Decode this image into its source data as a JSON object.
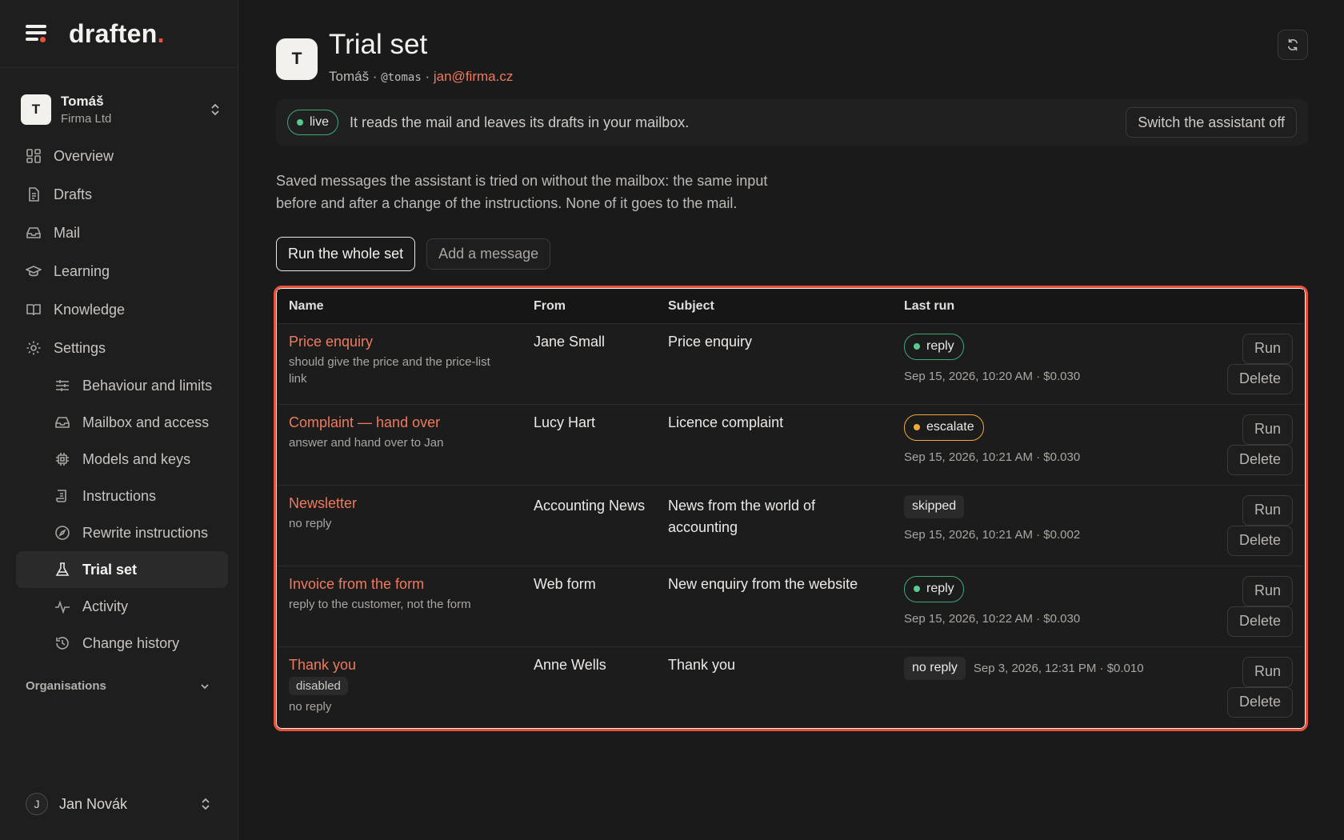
{
  "brand": {
    "logo_text": "draften",
    "logo_dot": ".",
    "accent": "#e5553b"
  },
  "org": {
    "avatar": "T",
    "name": "Tomáš",
    "company": "Firma Ltd"
  },
  "nav": {
    "overview": "Overview",
    "drafts": "Drafts",
    "mail": "Mail",
    "learning": "Learning",
    "knowledge": "Knowledge",
    "settings": "Settings",
    "behaviour": "Behaviour and limits",
    "mailbox": "Mailbox and access",
    "models": "Models and keys",
    "instructions": "Instructions",
    "rewrite": "Rewrite instructions",
    "trial_set": "Trial set",
    "activity": "Activity",
    "change_history": "Change history"
  },
  "organisations_label": "Organisations",
  "user": {
    "initial": "J",
    "name": "Jan Novák"
  },
  "page": {
    "avatar": "T",
    "title": "Trial set",
    "owner": "Tomáš",
    "sep1": " · ",
    "handle": "@tomas",
    "sep2": " · ",
    "email": "jan@firma.cz"
  },
  "status": {
    "pill": "live",
    "text": "It reads the mail and leaves its drafts in your mailbox.",
    "switch_off": "Switch the assistant off"
  },
  "intro": "Saved messages the assistant is tried on without the mailbox: the same input before and after a change of the instructions. None of it goes to the mail.",
  "actions": {
    "run_all": "Run the whole set",
    "add": "Add a message"
  },
  "table": {
    "headers": {
      "name": "Name",
      "from": "From",
      "subject": "Subject",
      "last_run": "Last run"
    },
    "buttons": {
      "run": "Run",
      "delete": "Delete"
    },
    "rows": [
      {
        "name": "Price enquiry",
        "note": "should give the price and the price-list link",
        "from": "Jane Small",
        "subject": "Price enquiry",
        "result": "reply",
        "meta": "Sep 15, 2026, 10:20 AM · $0.030"
      },
      {
        "name": "Complaint — hand over",
        "note": "answer and hand over to Jan",
        "from": "Lucy Hart",
        "subject": "Licence complaint",
        "result": "escalate",
        "meta": "Sep 15, 2026, 10:21 AM · $0.030"
      },
      {
        "name": "Newsletter",
        "note": "no reply",
        "from": "Accounting News",
        "subject": "News from the world of accounting",
        "result": "skipped",
        "meta": "Sep 15, 2026, 10:21 AM · $0.002"
      },
      {
        "name": "Invoice from the form",
        "note": "reply to the customer, not the form",
        "from": "Web form",
        "subject": "New enquiry from the website",
        "result": "reply",
        "meta": "Sep 15, 2026, 10:22 AM · $0.030"
      },
      {
        "name": "Thank you",
        "tag": "disabled",
        "note": "no reply",
        "from": "Anne Wells",
        "subject": "Thank you",
        "result": "no reply",
        "meta": "Sep 3, 2026, 12:31 PM · $0.010"
      }
    ]
  },
  "colors": {
    "link": "#ef7a5e",
    "highlight_border": "#e9533c",
    "ok": "#58c98f",
    "warn": "#f2a93b"
  },
  "icons": {
    "menu": "menu-icon",
    "updown": "chevron-up-down-icon",
    "overview": "grid-icon",
    "drafts": "document-icon",
    "mail": "inbox-icon",
    "learning": "graduation-cap-icon",
    "knowledge": "book-icon",
    "settings": "gear-icon",
    "behaviour": "sliders-icon",
    "mailbox": "inbox-icon",
    "models": "chip-icon",
    "instructions": "scroll-icon",
    "rewrite": "compass-icon",
    "trial_set": "flask-icon",
    "activity": "pulse-icon",
    "history": "history-icon",
    "refresh": "refresh-icon",
    "chevron_down": "chevron-down-icon"
  }
}
